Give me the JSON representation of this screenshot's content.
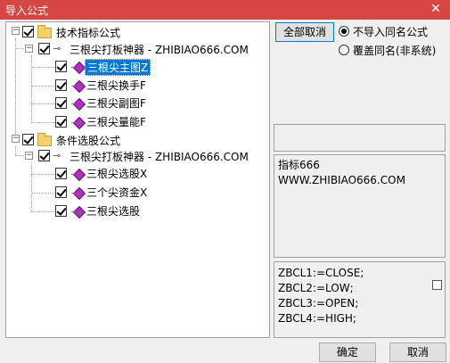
{
  "window": {
    "title": "导入公式",
    "close_glyph": "✕"
  },
  "tree": {
    "roots": [
      {
        "label": "技术指标公式",
        "children": [
          {
            "label": "三根尖打板神器 - ZHIBIAO666.COM",
            "items": [
              "三根尖主图Z",
              "三根尖换手F",
              "三根尖副图F",
              "三根尖量能F"
            ]
          }
        ]
      },
      {
        "label": "条件选股公式",
        "children": [
          {
            "label": "三根尖打板神器 - ZHIBIAO666.COM",
            "items": [
              "三根尖选股X",
              "三个尖资金X",
              "三根尖选股"
            ]
          }
        ]
      }
    ],
    "selected_item": "三根尖主图Z"
  },
  "controls": {
    "deselect_all": "全部取消",
    "radio_no_import": "不导入同名公式",
    "radio_overwrite": "覆盖同名(非系统)"
  },
  "info": {
    "lines": [
      "指标666",
      "WWW.ZHIBIAO666.COM"
    ]
  },
  "code": {
    "lines": [
      "ZBCL1:=CLOSE;",
      "ZBCL2:=LOW;",
      "ZBCL3:=OPEN;",
      "ZBCL4:=HIGH;"
    ]
  },
  "footer": {
    "ok": "确定",
    "cancel": "取消"
  }
}
